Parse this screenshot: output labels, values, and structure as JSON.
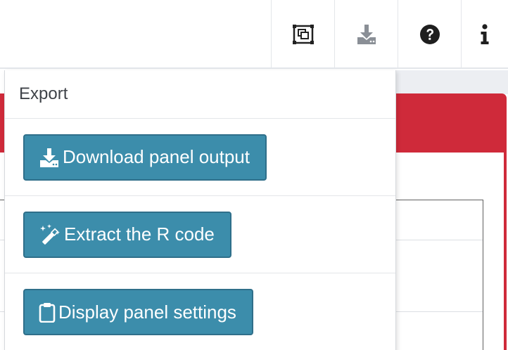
{
  "toolbar": {
    "buttons": [
      {
        "name": "fullscreen",
        "icon": "fullscreen-icon"
      },
      {
        "name": "download",
        "icon": "download-icon"
      },
      {
        "name": "help",
        "icon": "question-circle-icon"
      },
      {
        "name": "info",
        "icon": "info-icon"
      }
    ]
  },
  "popover": {
    "title": "Export",
    "actions": [
      {
        "label": "Download panel output",
        "icon": "download-icon"
      },
      {
        "label": "Extract the R code",
        "icon": "magic-wand-icon"
      },
      {
        "label": "Display panel settings",
        "icon": "clipboard-icon"
      }
    ]
  },
  "colors": {
    "panel_header": "#cf2a3a",
    "button_bg": "#3c8dab",
    "button_border": "#2f6f8a"
  }
}
